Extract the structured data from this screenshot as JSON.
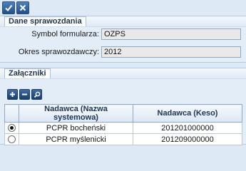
{
  "toolbar": {
    "confirm_icon": "checkmark-icon",
    "cancel_icon": "close-icon"
  },
  "report_section": {
    "title": "Dane sprawozdania",
    "form_symbol_label": "Symbol formularza:",
    "form_symbol_value": "OZPS",
    "period_label": "Okres sprawozdawczy:",
    "period_value": "2012"
  },
  "attachments_section": {
    "title": "Załączniki",
    "buttons": [
      {
        "icon": "plus-icon"
      },
      {
        "icon": "minus-icon"
      },
      {
        "icon": "magnifier-icon"
      }
    ],
    "columns": [
      "Nadawca (Nazwa systemowa)",
      "Nadawca (Keso)"
    ],
    "rows": [
      {
        "selected": true,
        "name": "PCPR bocheński",
        "keso": "201201000000"
      },
      {
        "selected": false,
        "name": "PCPR myślenicki",
        "keso": "201209000000"
      }
    ]
  },
  "colors": {
    "background": "#dde9f5",
    "panel_header": "#e3edf8",
    "button_blue": "#1f4f8c",
    "input_disabled": "#e9e9e9"
  }
}
